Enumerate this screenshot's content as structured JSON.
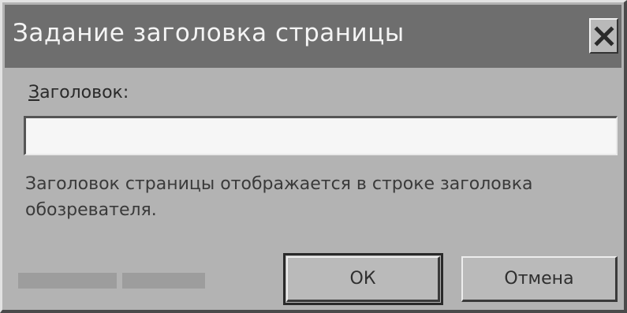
{
  "dialog": {
    "title": "Задание заголовка страницы",
    "close_glyph": "✕",
    "field_label_accel": "З",
    "field_label_rest": "аголовок:",
    "field_value": "",
    "description": "Заголовок страницы отображается в строке заголовка обозревателя.",
    "ok_label": "ОК",
    "cancel_label": "Отмена"
  }
}
